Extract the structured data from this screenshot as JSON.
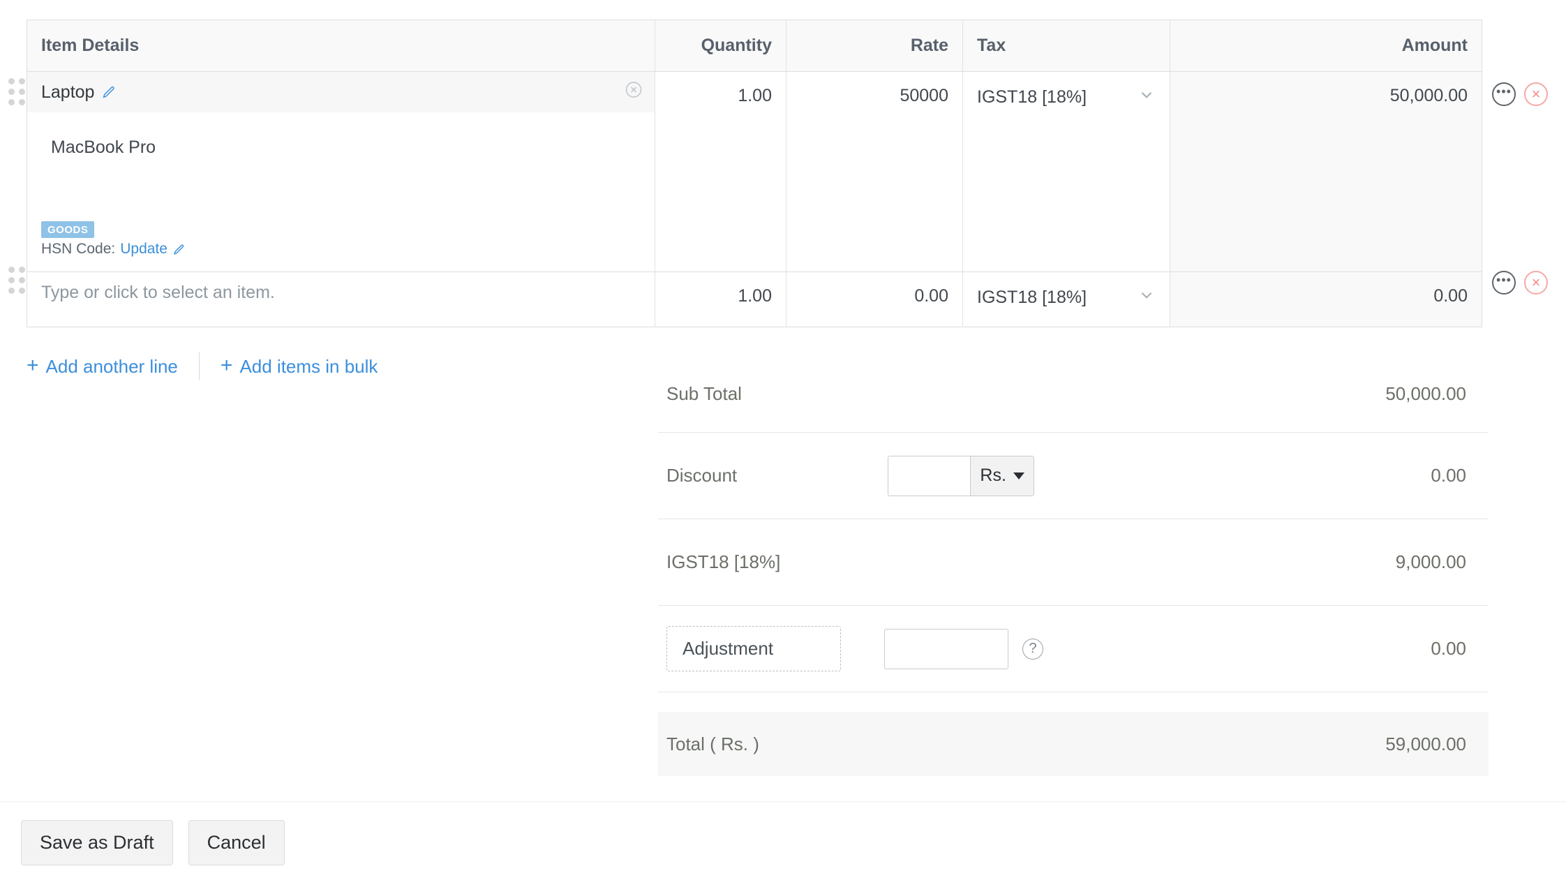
{
  "table": {
    "headers": {
      "item_details": "Item Details",
      "quantity": "Quantity",
      "rate": "Rate",
      "tax": "Tax",
      "amount": "Amount"
    },
    "rows": [
      {
        "name": "Laptop",
        "description": "MacBook Pro",
        "badge": "GOODS",
        "hsn_prefix": "HSN Code:",
        "hsn_link": "Update",
        "quantity": "1.00",
        "rate": "50000",
        "tax": "IGST18 [18%]",
        "amount": "50,000.00"
      },
      {
        "name": "Type or click to select an item.",
        "quantity": "1.00",
        "rate": "0.00",
        "tax": "IGST18 [18%]",
        "amount": "0.00"
      }
    ]
  },
  "actions": {
    "add_another_line": "Add another line",
    "add_items_in_bulk": "Add items in bulk",
    "plus": "+"
  },
  "totals": {
    "sub_total_label": "Sub Total",
    "sub_total_value": "50,000.00",
    "discount_label": "Discount",
    "discount_input_value": "",
    "discount_unit": "Rs.",
    "discount_value": "0.00",
    "tax_label": "IGST18 [18%]",
    "tax_value": "9,000.00",
    "adjustment_label": "Adjustment",
    "adjustment_input_value": "",
    "adjustment_help": "?",
    "adjustment_value": "0.00",
    "total_label": "Total ( Rs. )",
    "total_value": "59,000.00"
  },
  "footer": {
    "save_as_draft": "Save as Draft",
    "cancel": "Cancel"
  },
  "icons": {
    "pencil": "pencil-icon",
    "clear": "clear-circle-icon",
    "chevron_down": "chevron-down-icon",
    "more": "•••",
    "delete": "×",
    "clear_x": "×"
  },
  "colors": {
    "link": "#3b8fdb",
    "badge_goods_bg": "#8ec2e6",
    "delete_circle": "#f5a8a8",
    "header_bg": "#f9f9f9"
  }
}
